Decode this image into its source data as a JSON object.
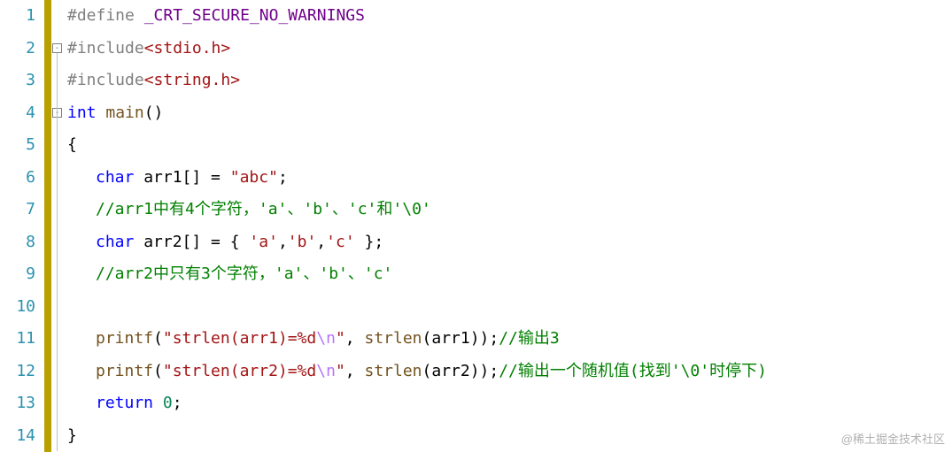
{
  "lineNumbers": [
    "1",
    "2",
    "3",
    "4",
    "5",
    "6",
    "7",
    "8",
    "9",
    "10",
    "11",
    "12",
    "13",
    "14"
  ],
  "code": {
    "l1": {
      "hash": "#define ",
      "macro": "_CRT_SECURE_NO_WARNINGS"
    },
    "l2": {
      "hash": "#include",
      "hdr": "<stdio.h>"
    },
    "l3": {
      "hash": "#include",
      "hdr": "<string.h>"
    },
    "l4": {
      "kw1": "int",
      "sp1": " ",
      "fn": "main",
      "paren": "()"
    },
    "l5": {
      "brace": "{"
    },
    "l6": {
      "kw": "char",
      "sp": " ",
      "id": "arr1[] = ",
      "str": "\"abc\"",
      "semi": ";"
    },
    "l7": {
      "cmt": "//arr1中有4个字符，'a'、'b'、'c'和'\\0'"
    },
    "l8": {
      "kw": "char",
      "sp": " ",
      "id": "arr2[] = { ",
      "s1": "'a'",
      "c1": ",",
      "s2": "'b'",
      "c2": ",",
      "s3": "'c'",
      "end": " };"
    },
    "l9": {
      "cmt": "//arr2中只有3个字符，'a'、'b'、'c'"
    },
    "l11": {
      "fn": "printf",
      "p1": "(",
      "str1": "\"strlen(arr1)=%d",
      "esc": "\\n",
      "str2": "\"",
      "c1": ", ",
      "fn2": "strlen",
      "arg": "(arr1));",
      "cmt": "//输出3"
    },
    "l12": {
      "fn": "printf",
      "p1": "(",
      "str1": "\"strlen(arr2)=%d",
      "esc": "\\n",
      "str2": "\"",
      "c1": ", ",
      "fn2": "strlen",
      "arg": "(arr2));",
      "cmt": "//输出一个随机值(找到'\\0'时停下)"
    },
    "l13": {
      "kw": "return",
      "sp": " ",
      "num": "0",
      "semi": ";"
    },
    "l14": {
      "brace": "}"
    }
  },
  "watermark": "@稀土掘金技术社区"
}
